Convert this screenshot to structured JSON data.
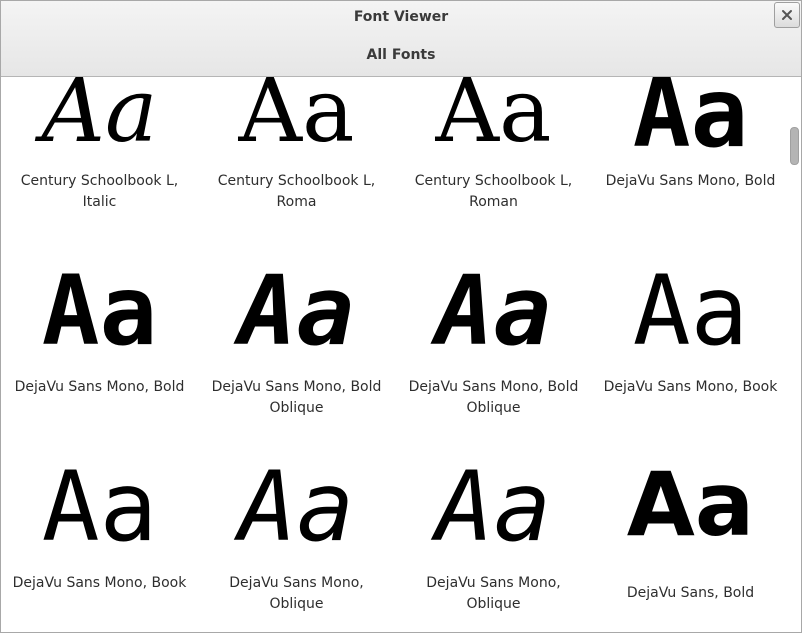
{
  "window": {
    "title": "Font Viewer",
    "subtitle": "All Fonts"
  },
  "fonts": [
    {
      "sample": "Aa",
      "label": "Century Schoolbook L, Italic"
    },
    {
      "sample": "Aa",
      "label": "Century Schoolbook L, Roma"
    },
    {
      "sample": "Aa",
      "label": "Century Schoolbook L, Roman"
    },
    {
      "sample": "Aa",
      "label": "DejaVu Sans Mono, Bold"
    },
    {
      "sample": "Aa",
      "label": "DejaVu Sans Mono, Bold"
    },
    {
      "sample": "Aa",
      "label": "DejaVu Sans Mono, Bold Oblique"
    },
    {
      "sample": "Aa",
      "label": "DejaVu Sans Mono, Bold Oblique"
    },
    {
      "sample": "Aa",
      "label": "DejaVu Sans Mono, Book"
    },
    {
      "sample": "Aa",
      "label": "DejaVu Sans Mono, Book"
    },
    {
      "sample": "Aa",
      "label": "DejaVu Sans Mono, Oblique"
    },
    {
      "sample": "Aa",
      "label": "DejaVu Sans Mono, Oblique"
    },
    {
      "sample": "Aa",
      "label": "DejaVu Sans, Bold"
    }
  ],
  "icons": {
    "close": "close-icon"
  }
}
